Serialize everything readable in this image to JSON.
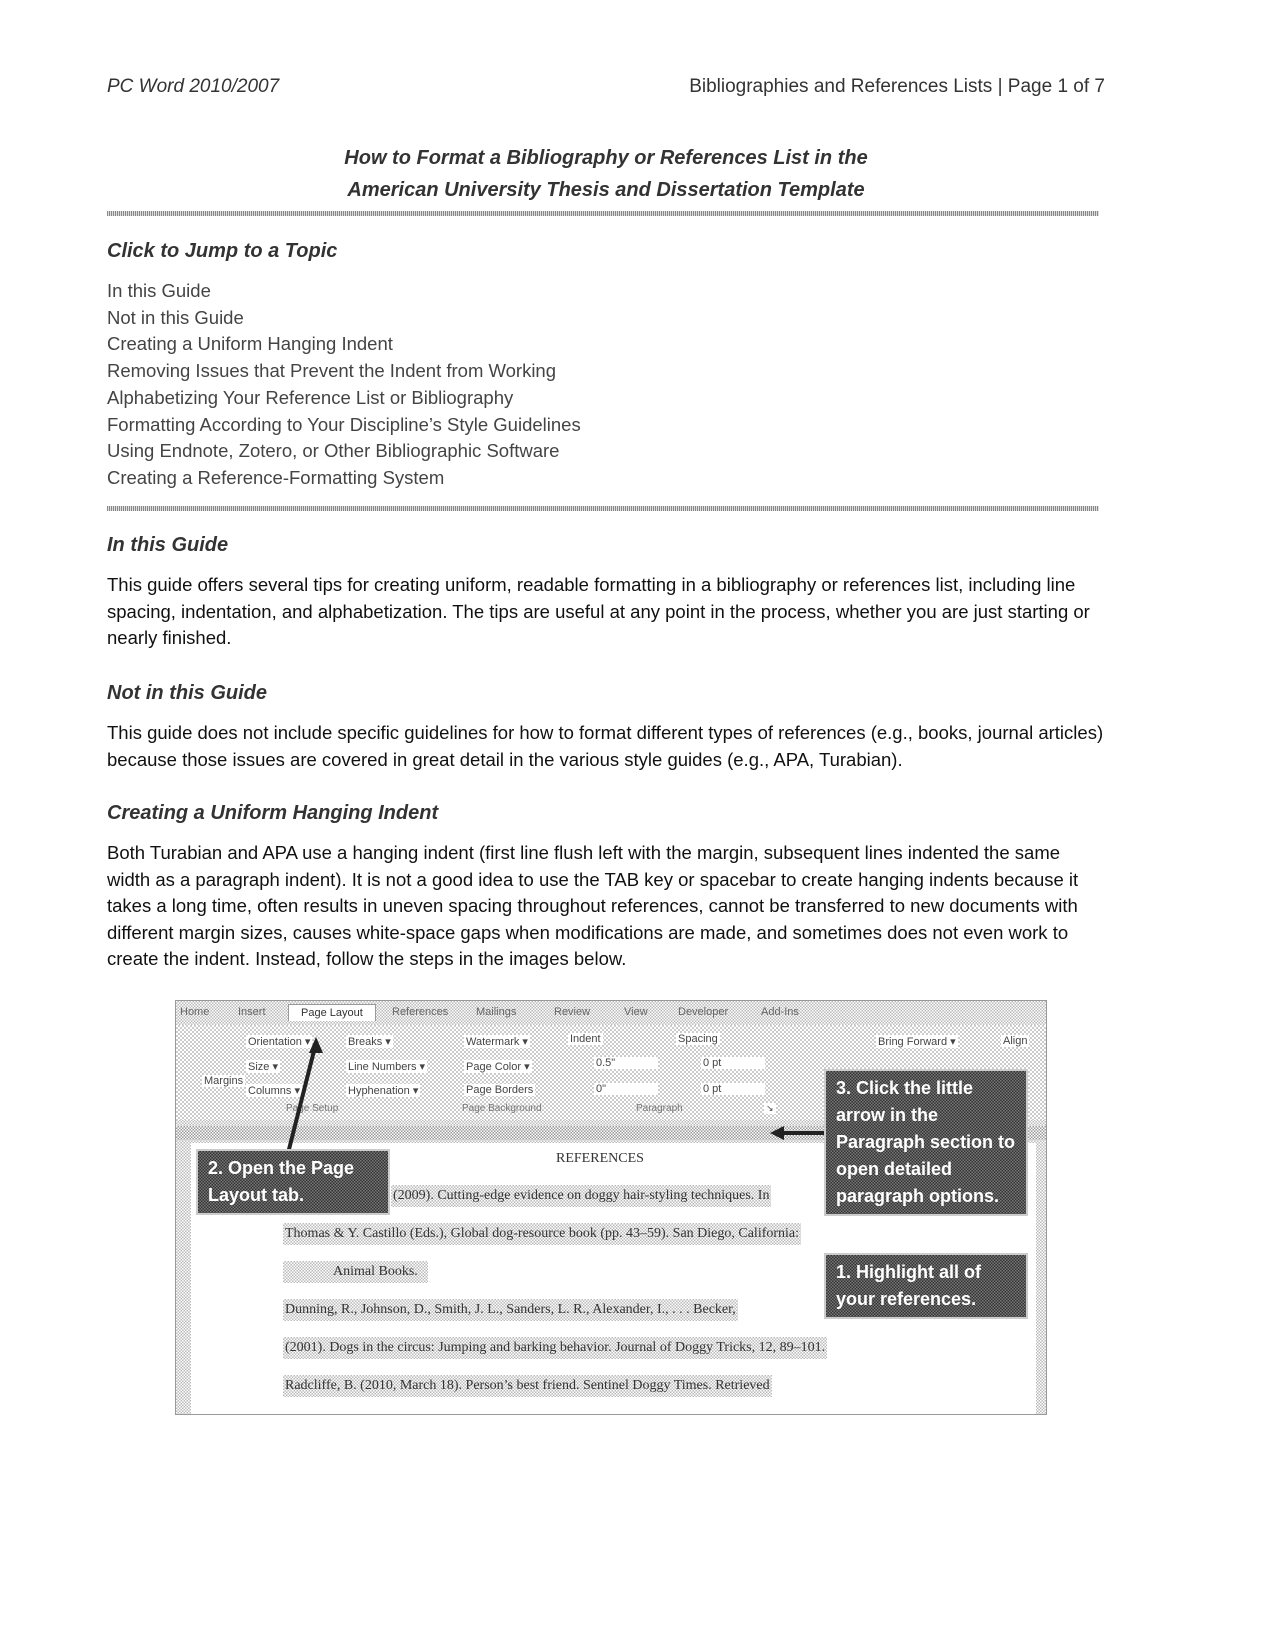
{
  "header": {
    "left": "PC Word 2010/2007",
    "right": "Bibliographies and References Lists | Page 1 of 7"
  },
  "title": {
    "line1": "How to Format a Bibliography or References List in the",
    "line2": "American University Thesis and Dissertation Template"
  },
  "toc": {
    "heading": "Click to Jump to a Topic",
    "items": [
      "In this Guide",
      "Not in this Guide",
      "Creating a Uniform Hanging Indent",
      "Removing Issues that Prevent the Indent from Working",
      "Alphabetizing Your Reference List or Bibliography",
      "Formatting According to Your Discipline’s Style Guidelines",
      "Using Endnote, Zotero, or Other Bibliographic Software",
      "Creating a Reference-Formatting System"
    ]
  },
  "sections": [
    {
      "heading": "In this Guide",
      "body": "This guide offers several tips for creating uniform, readable formatting in a bibliography or references list, including line spacing, indentation, and alphabetization. The tips are useful at any point in the process, whether you are just starting or nearly finished."
    },
    {
      "heading": "Not in this Guide",
      "body": "This guide does not include specific guidelines for how to format different types of references (e.g., books, journal articles) because those issues are covered in great detail in the various style guides (e.g., APA, Turabian)."
    },
    {
      "heading": "Creating a Uniform Hanging Indent",
      "body": "Both Turabian and APA use a hanging indent (first line flush left with the margin, subsequent lines indented the same width as a paragraph indent). It is not a good idea to use the TAB key or spacebar to create hanging indents because it takes a long time, often results in uneven spacing throughout references, cannot be transferred to new documents with different margin sizes, causes white-space gaps when modifications are made, and sometimes does not even work to create the indent. Instead, follow the steps in the images below."
    }
  ],
  "screenshot": {
    "tabs": [
      "Home",
      "Insert",
      "Page Layout",
      "References",
      "Mailings",
      "Review",
      "View",
      "Developer",
      "Add-Ins"
    ],
    "active_tab": "Page Layout",
    "ribbon": {
      "margins": "Margins",
      "orientation": "Orientation ▾",
      "size": "Size ▾",
      "columns": "Columns ▾",
      "breaks": "Breaks ▾",
      "line_numbers": "Line Numbers ▾",
      "hyphenation": "Hyphenation ▾",
      "watermark": "Watermark ▾",
      "page_color": "Page Color ▾",
      "page_borders": "Page Borders",
      "indent_label": "Indent",
      "indent_left": "0.5\"",
      "indent_right": "0\"",
      "spacing_label": "Spacing",
      "spacing_before": "0 pt",
      "spacing_after": "0 pt",
      "bring_forward": "Bring Forward ▾",
      "align": "Align",
      "group_page_setup": "Page Setup",
      "group_page_background": "Page Background",
      "group_paragraph": "Paragraph"
    },
    "document": {
      "heading": "REFERENCES",
      "lines": [
        "(2009). Cutting-edge evidence on doggy hair-styling techniques. In",
        "Thomas & Y. Castillo (Eds.), Global dog-resource book (pp. 43–59). San Diego, California:",
        "Animal Books.",
        "Dunning, R., Johnson, D., Smith, J. L., Sanders, L. R., Alexander, I., . . . Becker,",
        "(2001). Dogs in the circus: Jumping and barking behavior. Journal of Doggy Tricks, 12, 89–101.",
        "Radcliffe, B. (2010, March 18). Person’s best friend. Sentinel Doggy Times.    Retrieved"
      ]
    },
    "callouts": {
      "step1": "1. Highlight all of your references.",
      "step2": "2. Open the Page Layout tab.",
      "step3": "3. Click the little arrow in the Paragraph section to open detailed paragraph options."
    }
  }
}
